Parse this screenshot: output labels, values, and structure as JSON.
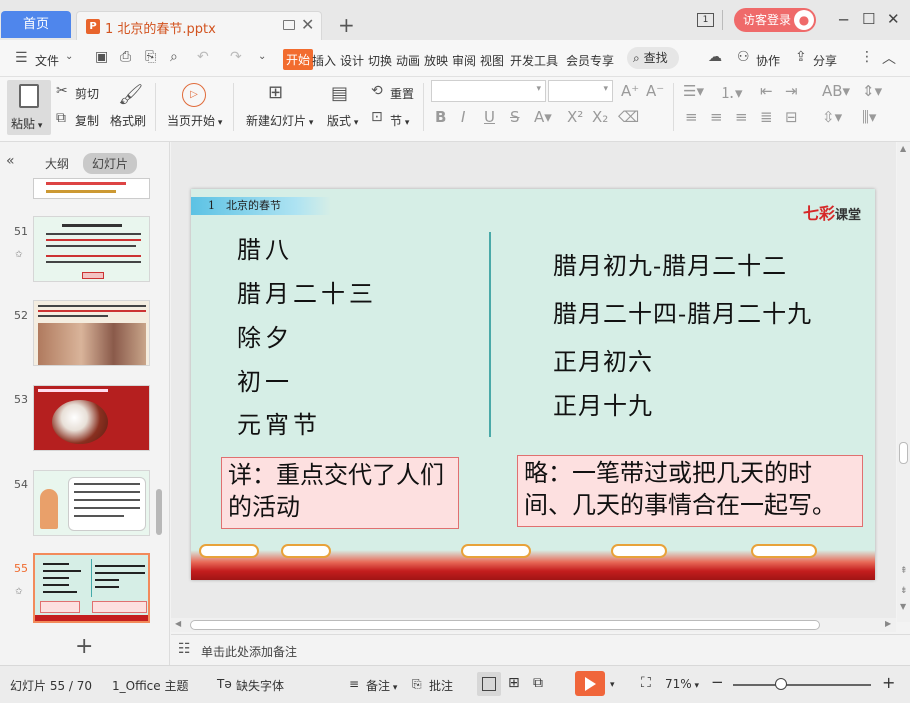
{
  "titlebar": {
    "home_tab": "首页",
    "doc_tab": "1 北京的春节.pptx",
    "page_icon": "1",
    "login": "访客登录"
  },
  "menubar": {
    "file": "文件",
    "items": [
      "开始",
      "插入",
      "设计",
      "切换",
      "动画",
      "放映",
      "审阅",
      "视图",
      "开发工具",
      "会员专享"
    ],
    "search": "查找",
    "collab": "协作",
    "share": "分享"
  },
  "ribbon": {
    "paste": "粘贴",
    "cut": "剪切",
    "copy": "复制",
    "format_painter": "格式刷",
    "from_current": "当页开始",
    "new_slide": "新建幻灯片",
    "layout": "版式",
    "reset": "重置",
    "section": "节"
  },
  "leftpanel": {
    "tab_outline": "大纲",
    "tab_slides": "幻灯片",
    "slide_numbers": [
      "51",
      "52",
      "53",
      "54",
      "55"
    ]
  },
  "slide": {
    "header": "1　北京的春节",
    "brand_a": "七彩",
    "brand_b": "课堂",
    "left_items": [
      "腊八",
      "腊月二十三",
      "除夕",
      "初一",
      "元宵节"
    ],
    "right_items": [
      "腊月初九-腊月二十二",
      "腊月二十四-腊月二十九",
      "正月初六",
      "正月十九"
    ],
    "note_left": "详：重点交代了人们的活动",
    "note_right": "略：一笔带过或把几天的时间、几天的事情合在一起写。"
  },
  "notes": {
    "placeholder": "单击此处添加备注"
  },
  "status": {
    "slide_count": "幻灯片 55 / 70",
    "theme": "1_Office 主题",
    "missing_font": "缺失字体",
    "notes_btn": "备注",
    "comments_btn": "批注",
    "zoom": "71%"
  }
}
